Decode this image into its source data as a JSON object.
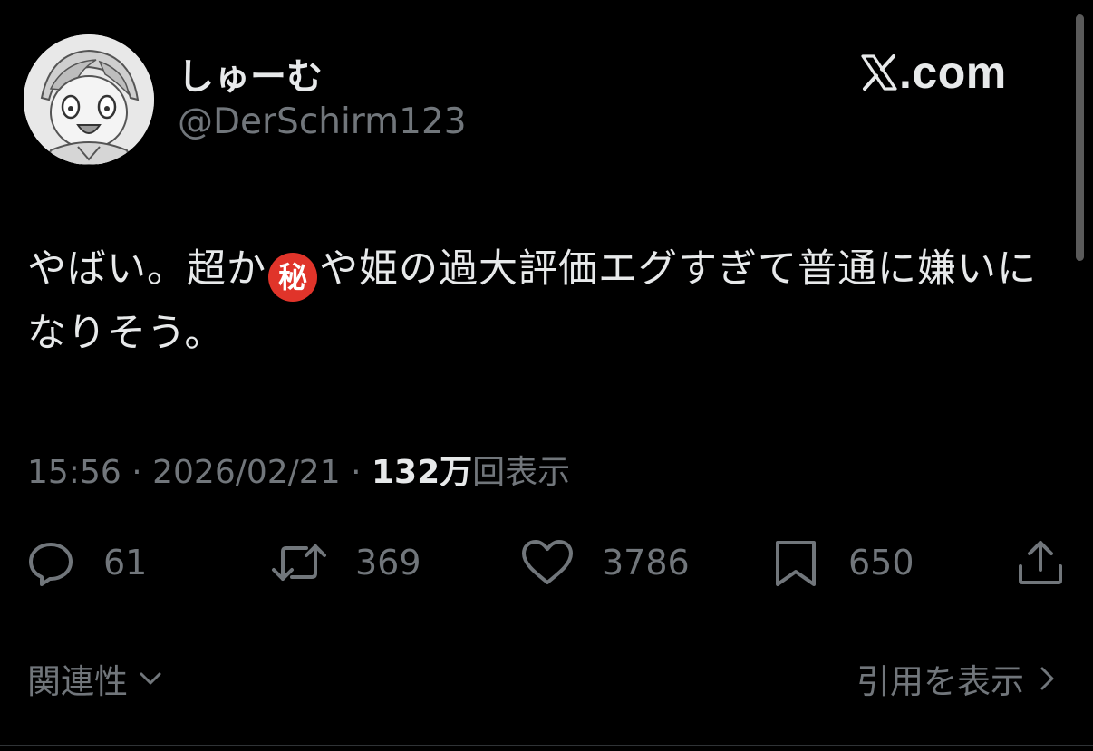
{
  "user": {
    "display_name": "しゅーむ",
    "handle": "@DerSchirm123"
  },
  "brand": {
    "text": ".com",
    "icon": "x-logo-icon"
  },
  "tweet": {
    "text_before_emoji": "やばい。超か",
    "emoji_char": "秘",
    "emoji_name": "japanese-secret-button",
    "text_after_emoji": "や姫の過大評価エグすぎて普通に嫌いになりそう。"
  },
  "meta": {
    "time": "15:56",
    "separator": "·",
    "date": "2026/02/21",
    "views_count": "132万",
    "views_label": "回表示"
  },
  "actions": {
    "replies": "61",
    "retweets": "369",
    "likes": "3786",
    "bookmarks": "650"
  },
  "footer": {
    "sort_label": "関連性",
    "quotes_label": "引用を表示"
  },
  "colors": {
    "background": "#000000",
    "primary_text": "#e7e9ea",
    "secondary_text": "#71767b",
    "emoji_red": "#e0342a"
  }
}
